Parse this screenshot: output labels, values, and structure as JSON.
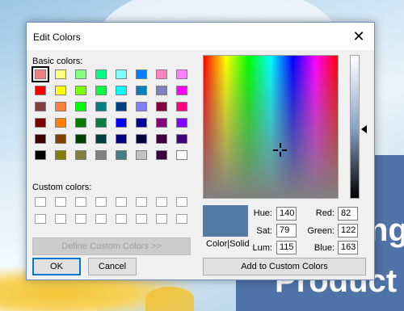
{
  "background": {
    "banner_line1": "ng",
    "banner_line2": "Product",
    "banner_color": "#4f73a8"
  },
  "dialog": {
    "title": "Edit Colors",
    "close_glyph": "✕",
    "basic_colors_label": "Basic colors:",
    "custom_colors_label": "Custom colors:",
    "basic_colors": [
      [
        "#f08080",
        "#ffff80",
        "#80ff80",
        "#00ff80",
        "#80ffff",
        "#0080ff",
        "#ff80c0",
        "#ff80ff"
      ],
      [
        "#ff0000",
        "#ffff00",
        "#80ff00",
        "#00ff40",
        "#00ffff",
        "#0080c0",
        "#8080c0",
        "#ff00ff"
      ],
      [
        "#804040",
        "#ff8040",
        "#00ff00",
        "#008080",
        "#004080",
        "#8080ff",
        "#800040",
        "#ff0080"
      ],
      [
        "#800000",
        "#ff8000",
        "#008000",
        "#008040",
        "#0000ff",
        "#0000a0",
        "#800080",
        "#8000ff"
      ],
      [
        "#400000",
        "#804000",
        "#004000",
        "#004040",
        "#000080",
        "#000040",
        "#400040",
        "#400080"
      ],
      [
        "#000000",
        "#808000",
        "#808040",
        "#808080",
        "#408080",
        "#c0c0c0",
        "#400040",
        "#ffffff"
      ]
    ],
    "selected_basic": "0,0",
    "custom_colors": [
      [
        "#ffffff",
        "#ffffff",
        "#ffffff",
        "#ffffff",
        "#ffffff",
        "#ffffff",
        "#ffffff",
        "#ffffff"
      ],
      [
        "#ffffff",
        "#ffffff",
        "#ffffff",
        "#ffffff",
        "#ffffff",
        "#ffffff",
        "#ffffff",
        "#ffffff"
      ]
    ],
    "define_custom_label": "Define Custom Colors >>",
    "ok_label": "OK",
    "cancel_label": "Cancel",
    "color_solid_label": "Color|Solid",
    "preview_color": "#527aa3",
    "hue_label": "Hue:",
    "sat_label": "Sat:",
    "lum_label": "Lum:",
    "red_label": "Red:",
    "green_label": "Green:",
    "blue_label": "Blue:",
    "hue": "140",
    "sat": "79",
    "lum": "115",
    "red": "82",
    "green": "122",
    "blue": "163",
    "add_custom_label": "Add to Custom Colors"
  }
}
